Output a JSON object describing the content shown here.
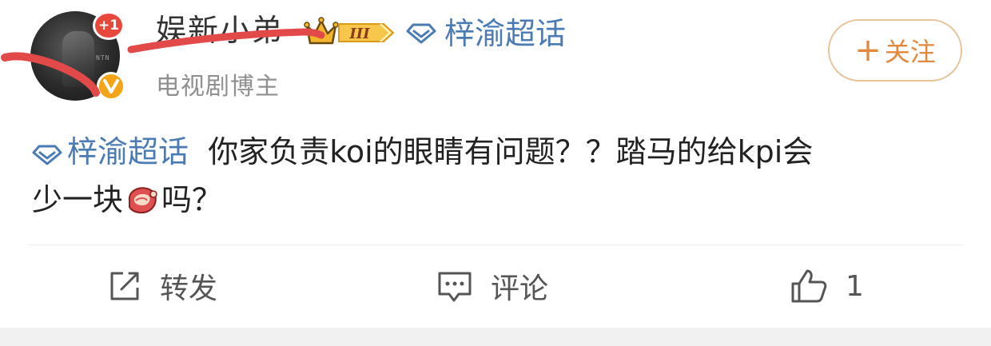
{
  "post": {
    "author": {
      "name": "娱新小弟",
      "notification_count": "+1",
      "level_badge": "III",
      "subtitle": "电视剧博主"
    },
    "header_topic": "梓渝超话",
    "follow_label": "关注",
    "follow_plus": "+",
    "body": {
      "topic": "梓渝超话",
      "text_line1": "你家负责koi的眼睛有问题？？踏马的给kpi会",
      "text_line2_before": "少一块",
      "text_line2_after": "吗？"
    },
    "actions": {
      "repost_label": "转发",
      "comment_label": "评论",
      "like_count": "1"
    }
  },
  "colors": {
    "topic_blue": "#4a7bb5",
    "follow_orange": "#e0893c",
    "follow_border": "#e7c39a",
    "notify_red": "#e8473c",
    "verify_gold": "#f3a417",
    "scribble_red": "#e24a4a"
  },
  "icons": {
    "notify": "notification-badge",
    "verified": "verified-v-icon",
    "crown": "crown-icon",
    "topic": "diamond-topic-icon",
    "steak": "steak-emoji-icon",
    "repost": "repost-icon",
    "comment": "comment-icon",
    "like": "thumbs-up-icon"
  }
}
